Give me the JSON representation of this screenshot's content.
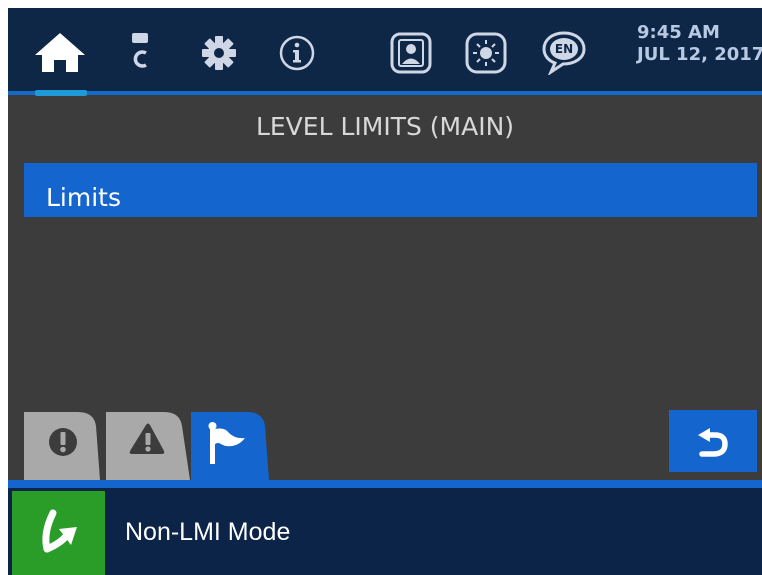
{
  "topbar": {
    "icons": [
      "home-icon",
      "level-sensor-icon",
      "gear-icon",
      "info-icon",
      "operator-profile-icon",
      "brightness-icon",
      "language-icon"
    ],
    "language_code": "EN",
    "time": "9:45 AM",
    "date": "JUL 12, 2017"
  },
  "page": {
    "title": "LEVEL LIMITS (MAIN)"
  },
  "list": {
    "items": [
      {
        "label": "Limits",
        "selected": true
      }
    ]
  },
  "tabs": [
    {
      "icon": "alarm-icon",
      "active": false
    },
    {
      "icon": "warning-icon",
      "active": false
    },
    {
      "icon": "flag-icon",
      "active": true
    }
  ],
  "footer": {
    "mode_label": "Non-LMI Mode",
    "mode_icon": "mode-arrow-icon"
  },
  "colors": {
    "accent_blue": "#1565cf",
    "topbar_bg": "#0f2747",
    "screen_bg": "#3c3c3c",
    "mode_green": "#2a9d28"
  }
}
